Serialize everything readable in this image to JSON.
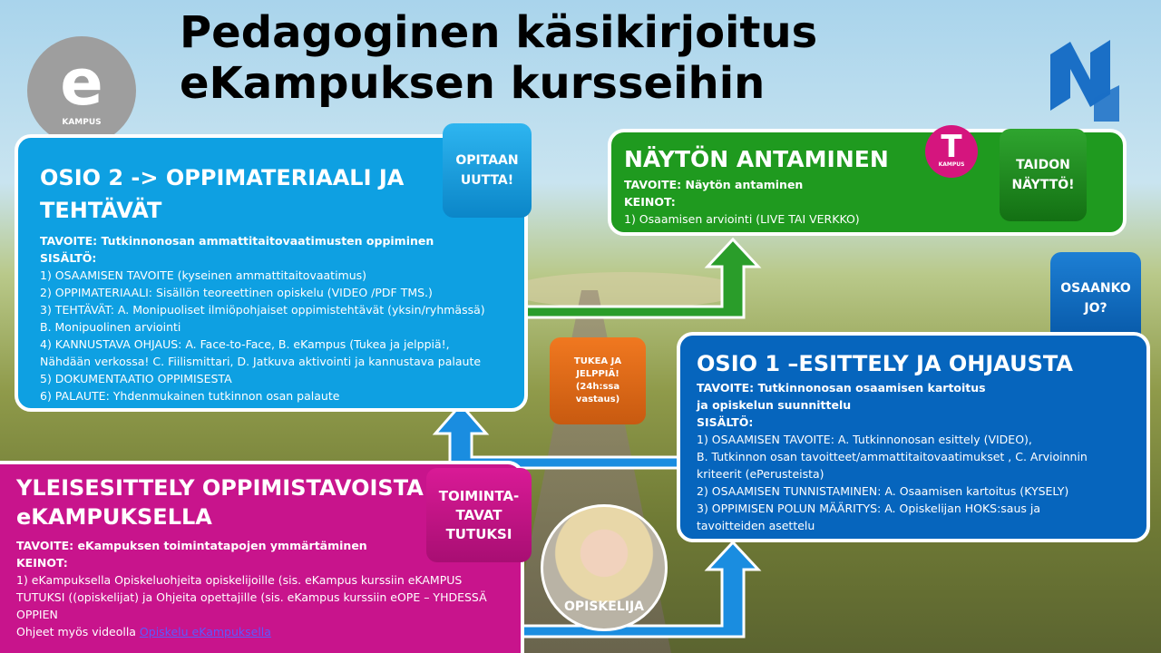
{
  "title": {
    "line1": "Pedagoginen käsikirjoitus",
    "line2": "eKampuksen kursseihin"
  },
  "logos": {
    "e": {
      "letter": "e",
      "caption": "KAMPUS",
      "color": "#9e9e9e"
    },
    "t": {
      "letter": "T",
      "caption": "KAMPUS",
      "color": "#d5157e"
    },
    "n": {
      "icon": "n-logo-icon",
      "color": "#1a6fc6"
    }
  },
  "osio2": {
    "heading": "OSIO 2 -> OPPIMATERIAALI JA TEHTÄVÄT",
    "tag": "OPITAAN UUTTA!",
    "lines": [
      "TAVOITE: Tutkinnonosan ammattitaitovaatimusten oppiminen",
      "SISÄLTÖ:",
      "1) OSAAMISEN TAVOITE (kyseinen ammattitaitovaatimus)",
      "2) OPPIMATERIAALI: Sisällön teoreettinen opiskelu (VIDEO /PDF TMS.)",
      "3) TEHTÄVÄT: A. Monipuoliset ilmiöpohjaiset oppimistehtävät (yksin/ryhmässä)",
      "B. Monipuolinen arviointi",
      "4) KANNUSTAVA OHJAUS: A. Face-to-Face, B. eKampus (Tukea ja jelppiä!,",
      "Nähdään verkossa! C. Fiilismittari, D. Jatkuva aktivointi ja kannustava palaute",
      "5) DOKUMENTAATIO OPPIMISESTA",
      "6) PALAUTE: Yhdenmukainen tutkinnon osan palaute"
    ]
  },
  "naytto": {
    "heading": "NÄYTÖN ANTAMINEN",
    "tag": "TAIDON NÄYTTÖ!",
    "lines": [
      "TAVOITE: Näytön antaminen",
      "KEINOT:",
      "1) Osaamisen arviointi (LIVE TAI VERKKO)"
    ]
  },
  "osaanko": "OSAANKO JO?",
  "tukea": {
    "line1": "TUKEA JA",
    "line2": "JELPPIÄ!",
    "line3": "(24h:ssa",
    "line4": "vastaus)"
  },
  "osio1": {
    "heading": "OSIO 1 –ESITTELY JA OHJAUSTA",
    "lines": [
      "TAVOITE: Tutkinnonosan osaamisen kartoitus",
      "ja opiskelun suunnittelu",
      "SISÄLTÖ:",
      "1) OSAAMISEN TAVOITE: A. Tutkinnonosan esittely (VIDEO),",
      "B. Tutkinnon osan tavoitteet/ammattitaitovaatimukset , C. Arvioinnin",
      "kriteerit (ePerusteista)",
      "2) OSAAMISEN TUNNISTAMINEN: A. Osaamisen kartoitus (KYSELY)",
      "3) OPPIMISEN POLUN MÄÄRITYS: A. Opiskelijan HOKS:saus ja",
      "tavoitteiden asettelu"
    ]
  },
  "yleis": {
    "heading1": "YLEISESITTELY OPPIMISTAVOISTA",
    "heading2": "eKAMPUKSELLA",
    "tag": "TOIMINTA-TAVAT TUTUKSI",
    "lines": [
      "TAVOITE: eKampuksen toimintatapojen ymmärtäminen",
      "KEINOT:",
      "1) eKampuksella Opiskeluohjeita opiskelijoille (sis. eKampus kurssiin eKAMPUS",
      "TUTUKSI ((opiskelijat) ja Ohjeita opettajille (sis. eKampus kurssiin eOPE – YHDESSÄ",
      "OPPIEN"
    ],
    "video_prefix": "Ohjeet myös videolla ",
    "video_link": "Opiskelu eKampuksella"
  },
  "photo_label": "OPISKELIJA",
  "colors": {
    "arrow_blue": "#1a8de0",
    "arrow_green": "#2a9d2a"
  }
}
